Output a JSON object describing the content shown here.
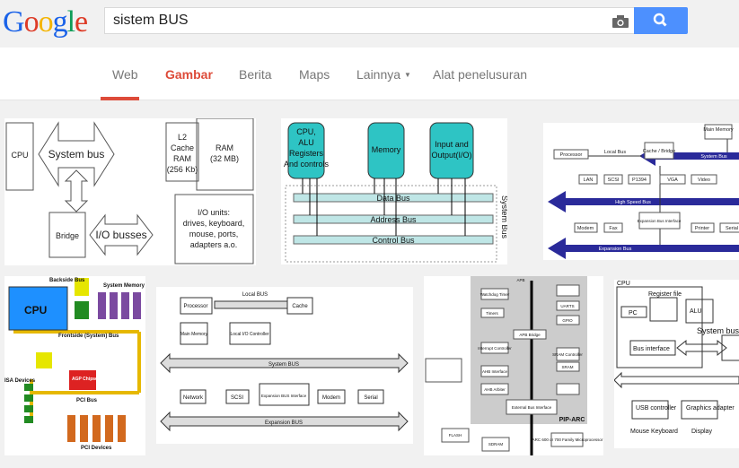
{
  "header": {
    "logo": "Google",
    "query": "sistem BUS",
    "camera_icon": "camera-icon",
    "search_icon": "magnifier-icon",
    "accent": "#4d90fe"
  },
  "nav": {
    "tabs": [
      {
        "label": "Web"
      },
      {
        "label": "Gambar",
        "active": true
      },
      {
        "label": "Berita"
      },
      {
        "label": "Maps"
      },
      {
        "label": "Lainnya"
      },
      {
        "label": "Alat penelusuran"
      }
    ],
    "active_color": "#dd4b39"
  },
  "results": [
    {
      "labels": [
        "CPU",
        "System bus",
        "L2",
        "Cache",
        "RAM",
        "(256 Kb)",
        "RAM",
        "(32 MB)",
        "Bridge",
        "I/O busses",
        "I/O units:",
        "drives, keyboard,",
        "mouse, ports,",
        "adapters a.o."
      ]
    },
    {
      "labels": [
        "CPU,",
        "ALU",
        "Registers",
        "And controls",
        "Memory",
        "Input and",
        "Output(I/O)",
        "Data Bus",
        "Address Bus",
        "Control Bus",
        "System Bus"
      ]
    },
    {
      "labels": [
        "Main Memory",
        "Processor",
        "Local Bus",
        "Cache / Bridge",
        "System Bus",
        "LAN",
        "SCSI",
        "P1394",
        "VGA",
        "Video",
        "High Speed Bus",
        "Modem",
        "Fax",
        "Expansion Bus Interface",
        "Printer",
        "Serial",
        "Expansion Bus"
      ]
    },
    {
      "labels": [
        "CPU",
        "Backside Bus",
        "System Memory",
        "Frontside (System) Bus",
        "AGP Chipset",
        "PCI Bus",
        "ISA Devices",
        "PCI Devices"
      ]
    },
    {
      "labels": [
        "Local BUS",
        "Processor",
        "Cache",
        "Main Memory",
        "Local I/O Controller",
        "System BUS",
        "Network",
        "SCSI",
        "Expansion BUS Interface",
        "Modem",
        "Serial",
        "Expansion BUS"
      ]
    },
    {
      "labels": [
        "APB",
        "Watchdog Timer",
        "Timers",
        "Interrupt Controller",
        "AHB Interface",
        "AHB Arbiter",
        "UARTS",
        "GPIO",
        "APB Bridge",
        "SRAM Controller",
        "SRAM",
        "External Bus Interface",
        "PIP-ARC",
        "FLASH",
        "SDRAM",
        "ARC 600 or 700 Family Microprocessor"
      ]
    },
    {
      "labels": [
        "CPU",
        "Register file",
        "PC",
        "ALU",
        "Bus interface",
        "System bus",
        "USB controller",
        "Graphics adapter",
        "Mouse Keyboard",
        "Display"
      ]
    }
  ]
}
